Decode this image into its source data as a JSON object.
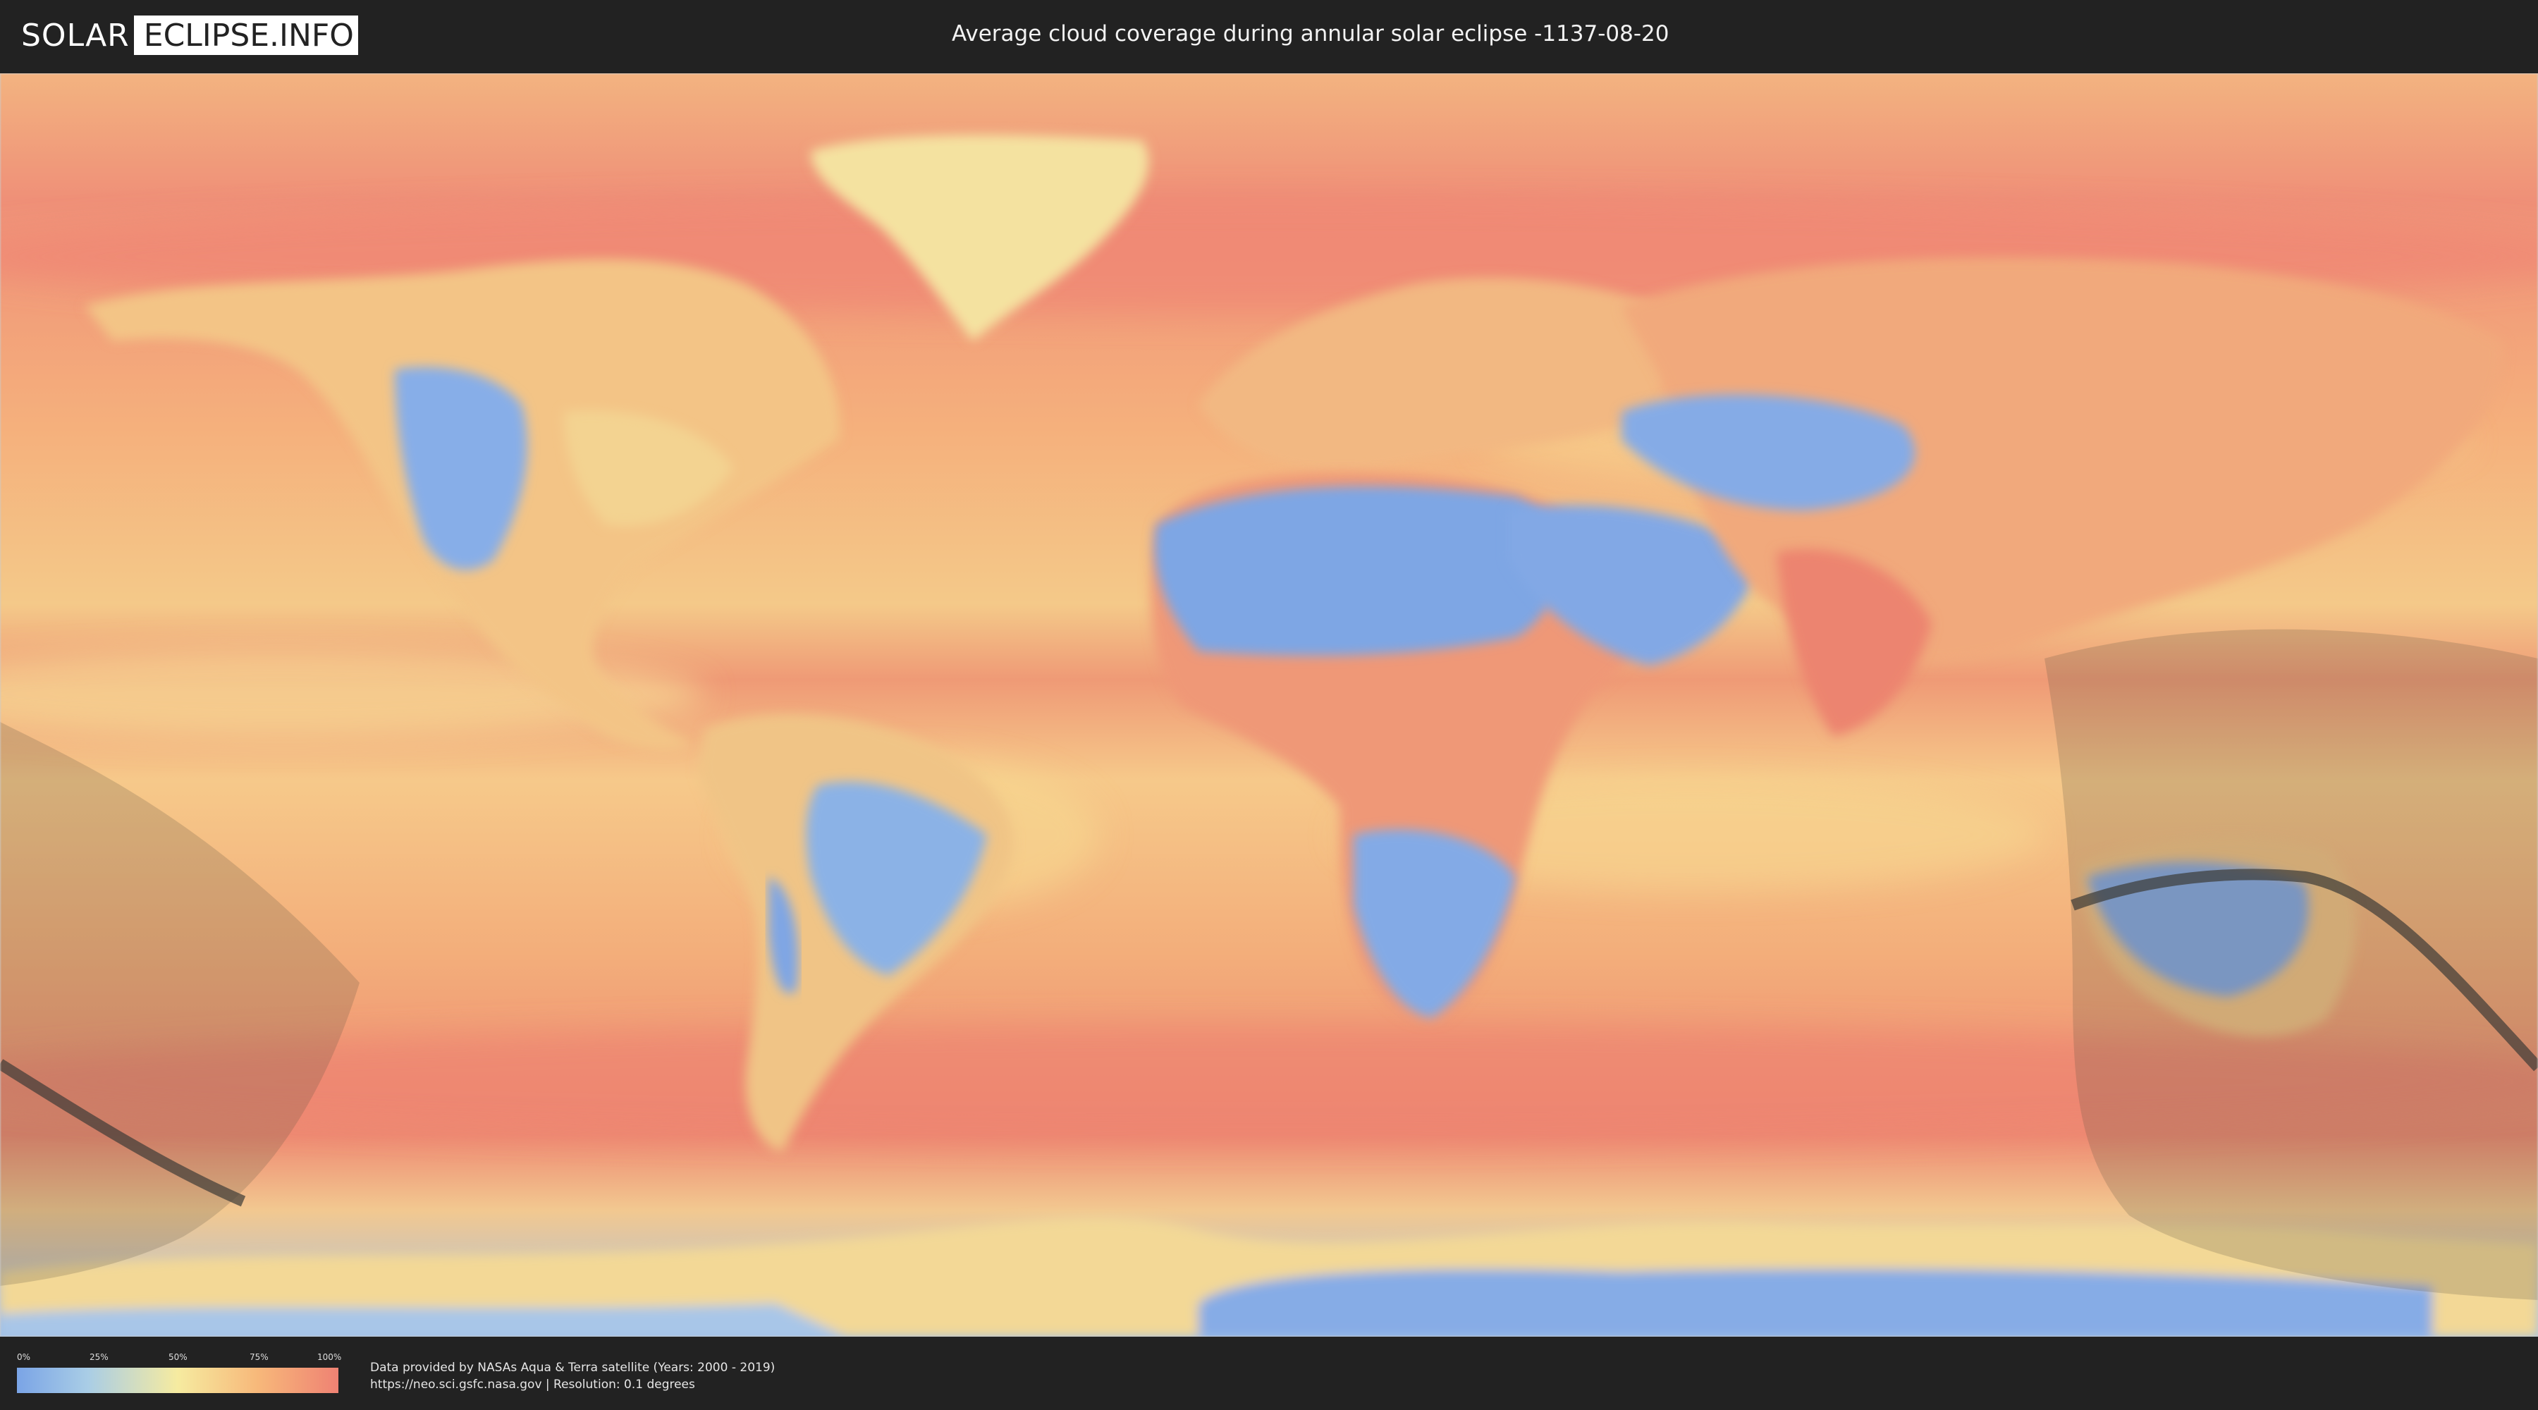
{
  "header": {
    "logo_left": "SOLAR",
    "logo_right": "ECLIPSE.INFO",
    "title": "Average cloud coverage during annular solar eclipse -1137-08-20"
  },
  "legend": {
    "ticks": [
      "0%",
      "25%",
      "50%",
      "75%",
      "100%"
    ],
    "scale_colors": [
      "#7aa4e6",
      "#a9cde6",
      "#f6eba0",
      "#f7b87a",
      "#ef8273"
    ]
  },
  "credits": {
    "line1": "Data provided by NASAs Aqua & Terra satellite (Years: 2000 - 2019)",
    "line2": "https://neo.sci.gsfc.nasa.gov | Resolution: 0.1 degrees"
  },
  "map": {
    "colors": {
      "ocean_cloudy": "#ef8a73",
      "ocean_mid": "#f6b27a",
      "clear": "#7fa6e4",
      "moderate": "#f3de98",
      "eclipse_shade": "#5a5040",
      "central_line": "#3c3a36"
    }
  }
}
